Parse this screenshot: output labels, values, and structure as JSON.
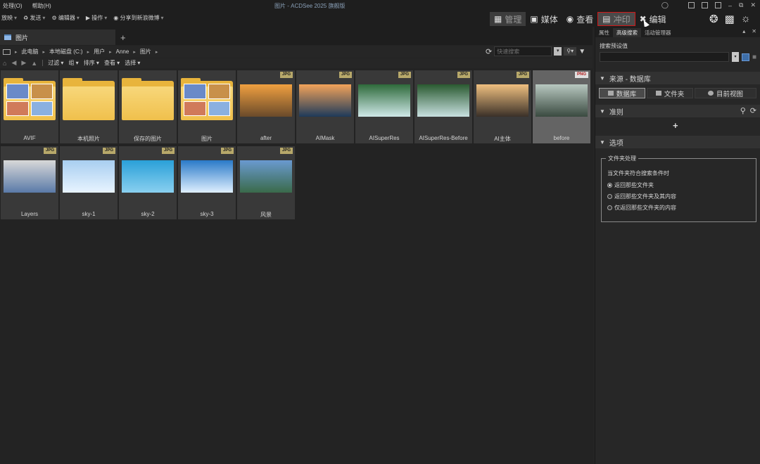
{
  "titlebar": {
    "menus": [
      "处理(O)",
      "帮助(H)"
    ],
    "title": "图片 - ACDSee 2025 旗舰版"
  },
  "toolbar": {
    "tools": [
      "放映",
      "发送",
      "编辑器",
      "操作",
      "分享到新浪微博"
    ],
    "modes": [
      "管理",
      "媒体",
      "查看",
      "冲印",
      "编辑"
    ]
  },
  "browser": {
    "tab_label": "图片",
    "path": [
      "此电脑",
      "本地磁盘 (C:)",
      "用户",
      "Anne",
      "图片"
    ],
    "search_placeholder": "快速搜索",
    "filter_items": [
      "过滤",
      "组",
      "排序",
      "查看",
      "选择"
    ],
    "tiles": [
      {
        "label": "AVIF",
        "kind": "folder",
        "badge": ""
      },
      {
        "label": "本机照片",
        "kind": "folder-empty",
        "badge": ""
      },
      {
        "label": "保存的图片",
        "kind": "folder-empty",
        "badge": ""
      },
      {
        "label": "图片",
        "kind": "folder",
        "badge": ""
      },
      {
        "label": "after",
        "kind": "image",
        "badge": "JPG",
        "colors": [
          "#f0a040",
          "#6a4a2a"
        ]
      },
      {
        "label": "AIMask",
        "kind": "image",
        "badge": "JPG",
        "colors": [
          "#f3a35a",
          "#1e3a5a"
        ]
      },
      {
        "label": "AISuperRes",
        "kind": "image",
        "badge": "JPG",
        "colors": [
          "#2e6a3a",
          "#cfe8e8"
        ]
      },
      {
        "label": "AISuperRes-Before",
        "kind": "image",
        "badge": "JPG",
        "colors": [
          "#2a5a30",
          "#c8e0e0"
        ]
      },
      {
        "label": "AI主体",
        "kind": "image",
        "badge": "JPG",
        "colors": [
          "#f0c080",
          "#3a3028"
        ]
      },
      {
        "label": "before",
        "kind": "image",
        "badge": "PNG",
        "colors": [
          "#b8c8c0",
          "#3a4a40"
        ]
      },
      {
        "label": "Layers",
        "kind": "image",
        "badge": "JPG",
        "colors": [
          "#d8d8d8",
          "#5a7aa8"
        ]
      },
      {
        "label": "sky-1",
        "kind": "image",
        "badge": "JPG",
        "colors": [
          "#a8cef0",
          "#e8f4ff"
        ]
      },
      {
        "label": "sky-2",
        "kind": "image",
        "badge": "JPG",
        "colors": [
          "#2aa0d8",
          "#8ad0f0"
        ]
      },
      {
        "label": "sky-3",
        "kind": "image",
        "badge": "JPG",
        "colors": [
          "#2a7ac8",
          "#e0f0ff"
        ]
      },
      {
        "label": "风景",
        "kind": "image",
        "badge": "JPG",
        "colors": [
          "#6a9ad0",
          "#3a6a4a"
        ]
      }
    ]
  },
  "rpane": {
    "tabs": [
      "属性",
      "高级搜索",
      "活动管理器"
    ],
    "preset_label": "搜索预设值",
    "source_section": "来源 - 数据库",
    "source_buttons": [
      "数据库",
      "文件夹",
      "目前视图"
    ],
    "criteria_section": "准则",
    "options_section": "选项",
    "folder_box_title": "文件夹处理",
    "folder_box_question": "当文件夹符合搜索条件时",
    "radios": [
      "返回那些文件夹",
      "返回那些文件夹及其内容",
      "仅返回那些文件夹的内容"
    ]
  }
}
